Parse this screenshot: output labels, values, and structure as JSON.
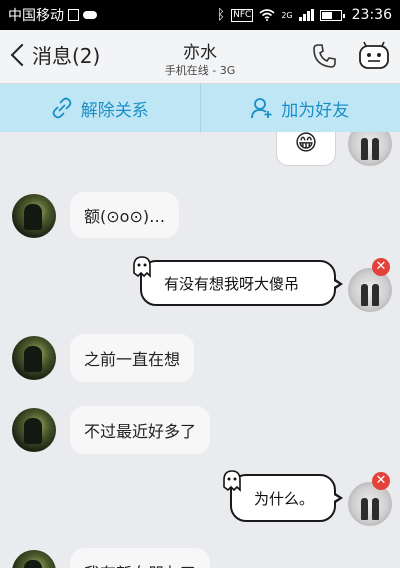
{
  "status_bar": {
    "carrier": "中国移动",
    "network_badge": "2G",
    "nfc_label": "NFC",
    "time": "23:36",
    "battery_level": 0.55,
    "icons": [
      "sim-icon",
      "cloud-icon",
      "bluetooth-icon",
      "nfc-icon",
      "wifi-icon",
      "signal-icon",
      "battery-icon"
    ]
  },
  "header": {
    "back_label": "消息(2)",
    "contact_name": "亦水",
    "contact_status": "手机在线 - 3G",
    "icons": [
      "phone-icon",
      "robot-icon"
    ]
  },
  "actions": {
    "unfriend_label": "解除关系",
    "add_friend_label": "加为好友"
  },
  "messages": [
    {
      "side": "right",
      "type": "emoji",
      "text": "😁",
      "status": "sent"
    },
    {
      "side": "left",
      "text": "额(⊙o⊙)…"
    },
    {
      "side": "right",
      "text": "有没有想我呀大傻吊",
      "status": "failed"
    },
    {
      "side": "left",
      "text": "之前一直在想"
    },
    {
      "side": "left",
      "text": "不过最近好多了"
    },
    {
      "side": "right",
      "text": "为什么。",
      "status": "failed"
    },
    {
      "side": "left",
      "text": "我有新女朋友了"
    }
  ],
  "fail_symbol": "✕"
}
